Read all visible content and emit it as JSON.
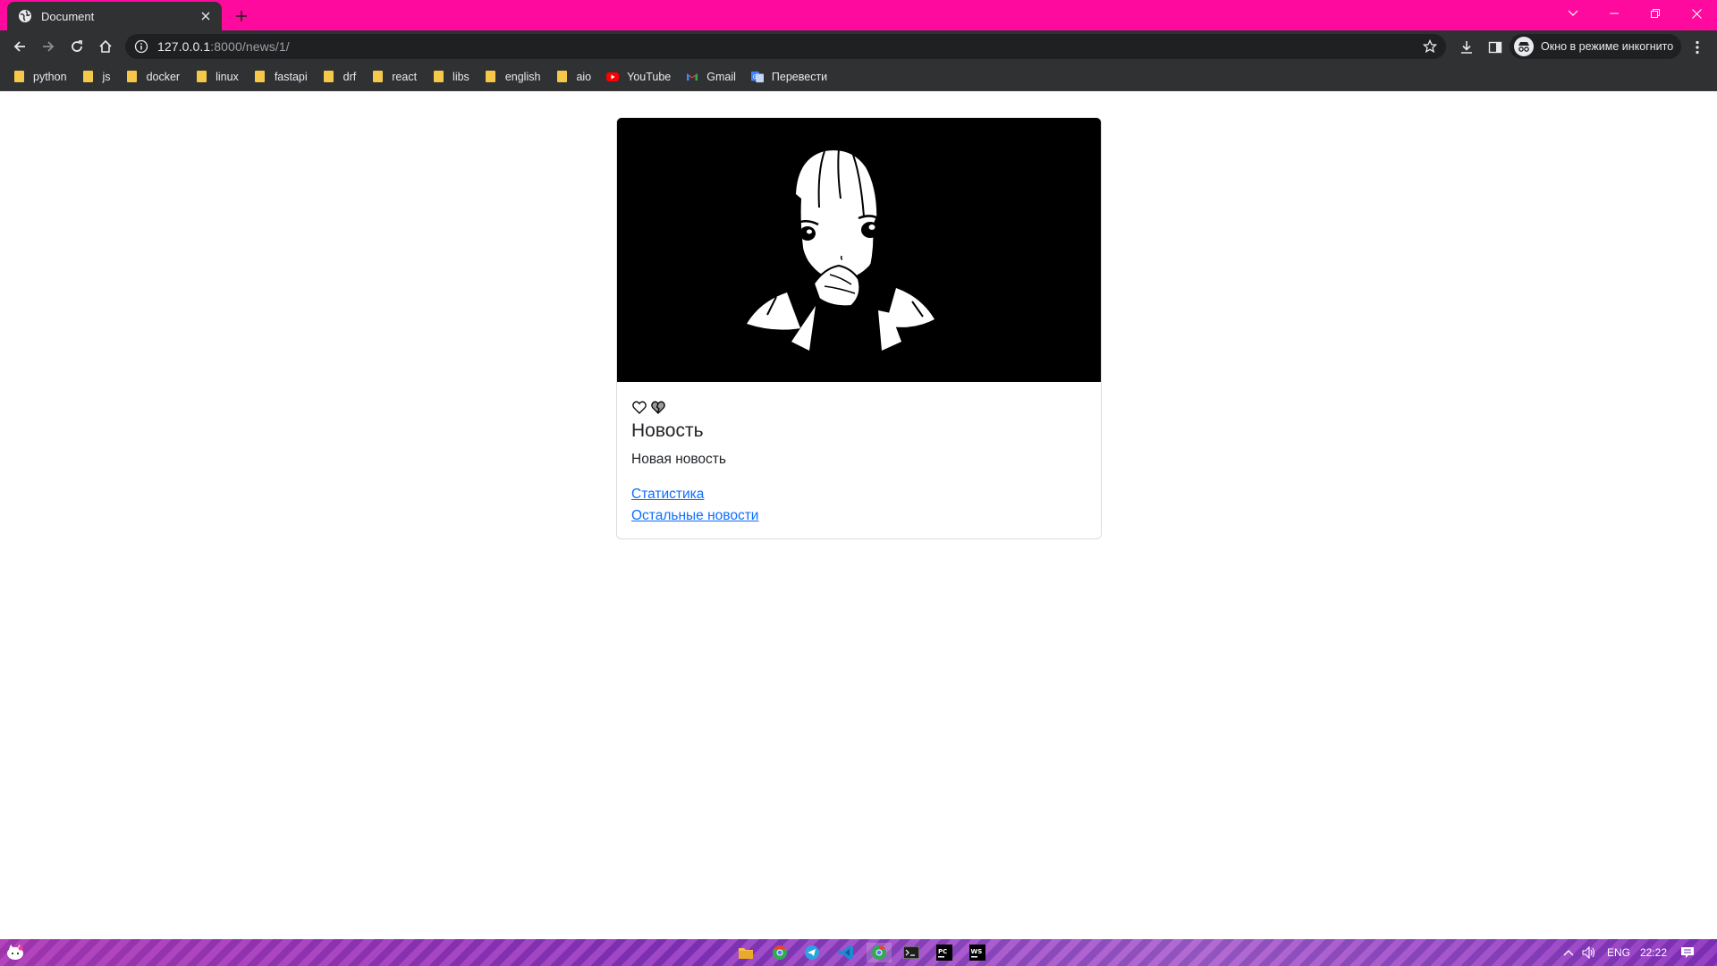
{
  "browser": {
    "tab_title": "Document",
    "url_host": "127.0.0.1",
    "url_rest": ":8000/news/1/",
    "profile_label": "Окно в режиме инкогнито",
    "bookmarks": [
      {
        "label": "python",
        "icon": "folder"
      },
      {
        "label": "js",
        "icon": "folder"
      },
      {
        "label": "docker",
        "icon": "folder"
      },
      {
        "label": "linux",
        "icon": "folder"
      },
      {
        "label": "fastapi",
        "icon": "folder"
      },
      {
        "label": "drf",
        "icon": "folder"
      },
      {
        "label": "react",
        "icon": "folder"
      },
      {
        "label": "libs",
        "icon": "folder"
      },
      {
        "label": "english",
        "icon": "folder"
      },
      {
        "label": "aio",
        "icon": "folder"
      },
      {
        "label": "YouTube",
        "icon": "youtube-icon"
      },
      {
        "label": "Gmail",
        "icon": "gmail-icon"
      },
      {
        "label": "Перевести",
        "icon": "translate-icon"
      }
    ]
  },
  "news": {
    "image_alt": "anime-girl-illustration",
    "reactions": [
      "heart-icon",
      "broken-heart-icon"
    ],
    "title": "Новость",
    "text": "Новая новость",
    "links": {
      "stats": "Статистика",
      "other_news": "Остальные новости"
    }
  },
  "taskbar": {
    "language": "ENG",
    "time": "22:22"
  },
  "colors": {
    "titlebar": "#ff0a9e",
    "link": "#0d6efd"
  }
}
